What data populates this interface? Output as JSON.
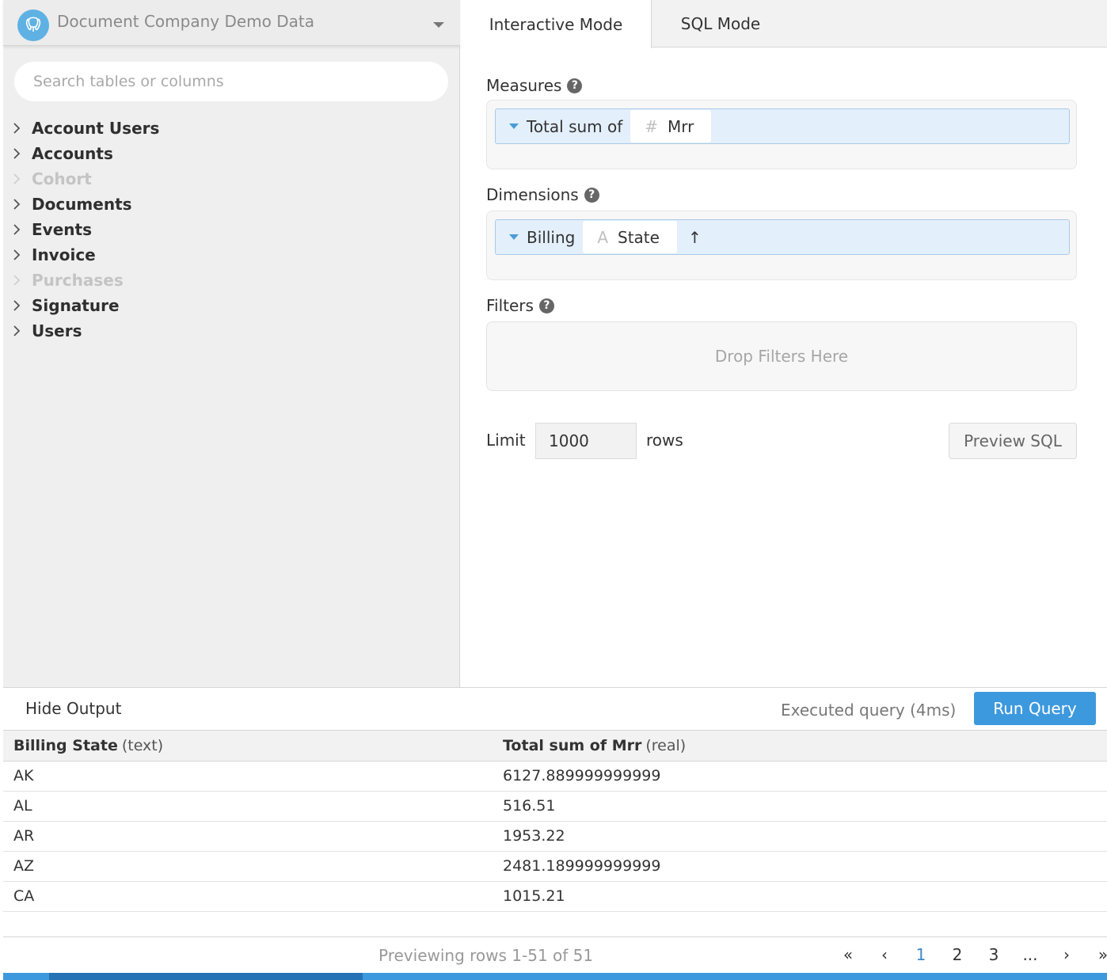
{
  "datasource": {
    "name": "Document Company Demo Data"
  },
  "search": {
    "placeholder": "Search tables or columns"
  },
  "tables": [
    {
      "label": "Account Users",
      "disabled": false
    },
    {
      "label": "Accounts",
      "disabled": false
    },
    {
      "label": "Cohort",
      "disabled": true
    },
    {
      "label": "Documents",
      "disabled": false
    },
    {
      "label": "Events",
      "disabled": false
    },
    {
      "label": "Invoice",
      "disabled": false
    },
    {
      "label": "Purchases",
      "disabled": true
    },
    {
      "label": "Signature",
      "disabled": false
    },
    {
      "label": "Users",
      "disabled": false
    }
  ],
  "tabs": {
    "interactive": "Interactive Mode",
    "sql": "SQL Mode"
  },
  "measures": {
    "label": "Measures",
    "aggregation": "Total sum of",
    "field_type_icon": "#",
    "field": "Mrr"
  },
  "dimensions": {
    "label": "Dimensions",
    "prefix": "Billing",
    "field_type_icon": "A",
    "field": "State",
    "sort_icon": "↑"
  },
  "filters": {
    "label": "Filters",
    "placeholder": "Drop Filters Here"
  },
  "limit": {
    "label": "Limit",
    "value": "1000",
    "suffix": "rows"
  },
  "preview_sql": "Preview SQL",
  "output": {
    "hide_label": "Hide Output",
    "status": "Executed query (4ms)",
    "run_label": "Run Query",
    "columns": [
      {
        "name": "Billing State",
        "type": "(text)"
      },
      {
        "name": "Total sum of Mrr",
        "type": "(real)"
      }
    ],
    "rows": [
      [
        "AK",
        "6127.889999999999"
      ],
      [
        "AL",
        "516.51"
      ],
      [
        "AR",
        "1953.22"
      ],
      [
        "AZ",
        "2481.189999999999"
      ],
      [
        "CA",
        "1015.21"
      ]
    ],
    "preview_text": "Previewing rows 1-51 of 51",
    "pagination": [
      "«",
      "‹",
      "1",
      "2",
      "3",
      "...",
      "›",
      "»"
    ],
    "current_page": "1"
  },
  "colors": {
    "accent": "#3d99de",
    "pill_bg": "#e3effb",
    "pill_border": "#a9cbe8"
  }
}
